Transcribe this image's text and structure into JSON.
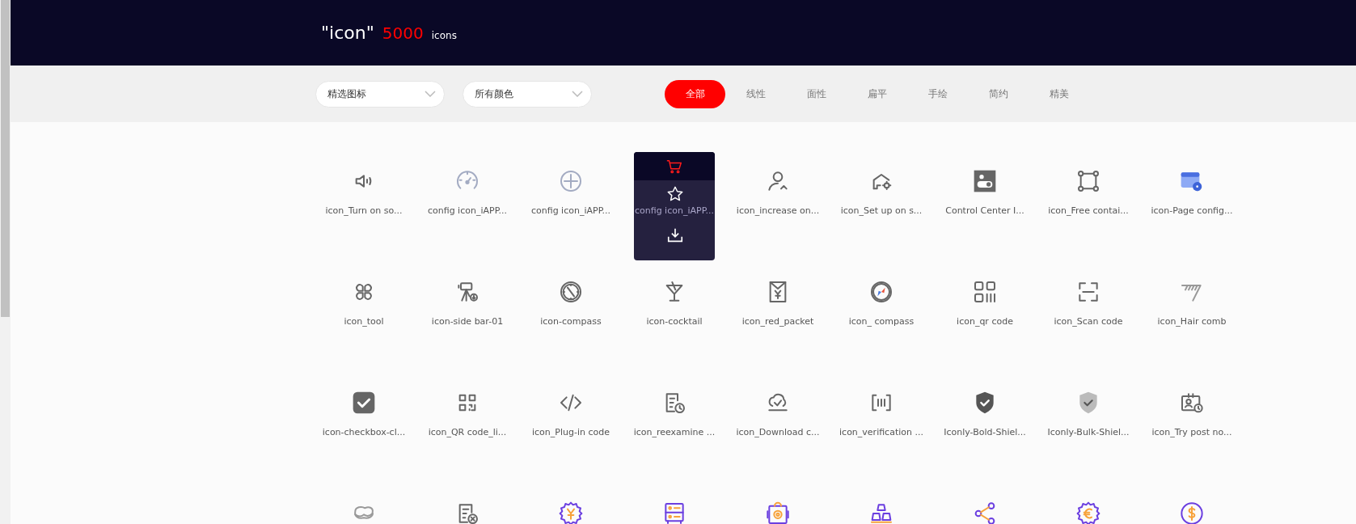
{
  "header": {
    "query": "\"icon\"",
    "count": "5000",
    "unit": "icons"
  },
  "filters": {
    "dropdowns": [
      {
        "value": "精选图标"
      },
      {
        "value": "所有颜色"
      }
    ],
    "tabs": [
      {
        "label": "全部",
        "selected": true
      },
      {
        "label": "线性",
        "selected": false
      },
      {
        "label": "面性",
        "selected": false
      },
      {
        "label": "扁平",
        "selected": false
      },
      {
        "label": "手绘",
        "selected": false
      },
      {
        "label": "简约",
        "selected": false
      },
      {
        "label": "精美",
        "selected": false
      }
    ]
  },
  "icons": [
    {
      "label": "icon_Turn on so...",
      "hovered": false
    },
    {
      "label": "config icon_iAPP...",
      "hovered": false
    },
    {
      "label": "config icon_iAPP...",
      "hovered": false
    },
    {
      "label": "config icon_iAPP...",
      "hovered": true
    },
    {
      "label": "icon_increase on...",
      "hovered": false
    },
    {
      "label": "icon_Set up on s...",
      "hovered": false
    },
    {
      "label": "Control Center I...",
      "hovered": false
    },
    {
      "label": "icon_Free contai...",
      "hovered": false
    },
    {
      "label": "icon-Page config...",
      "hovered": false
    },
    {
      "label": "icon_tool",
      "hovered": false
    },
    {
      "label": "icon-side bar-01",
      "hovered": false
    },
    {
      "label": "icon-compass",
      "hovered": false
    },
    {
      "label": "icon-cocktail",
      "hovered": false
    },
    {
      "label": "icon_red_packet",
      "hovered": false
    },
    {
      "label": "icon_ compass",
      "hovered": false
    },
    {
      "label": "icon_qr code",
      "hovered": false
    },
    {
      "label": "icon_Scan code",
      "hovered": false
    },
    {
      "label": "icon_Hair comb",
      "hovered": false
    },
    {
      "label": "icon-checkbox-cl...",
      "hovered": false
    },
    {
      "label": "icon_QR code_li...",
      "hovered": false
    },
    {
      "label": "icon_Plug-in code",
      "hovered": false
    },
    {
      "label": "icon_reexamine ...",
      "hovered": false
    },
    {
      "label": "icon_Download c...",
      "hovered": false
    },
    {
      "label": "icon_verification ...",
      "hovered": false
    },
    {
      "label": "Iconly-Bold-Shiel...",
      "hovered": false
    },
    {
      "label": "Iconly-Bulk-Shiel...",
      "hovered": false
    },
    {
      "label": "icon_Try post no...",
      "hovered": false
    },
    {
      "hovered": false
    },
    {
      "hovered": false
    },
    {
      "hovered": false
    },
    {
      "hovered": false
    },
    {
      "hovered": false
    },
    {
      "hovered": false
    },
    {
      "hovered": false
    },
    {
      "hovered": false
    },
    {
      "hovered": false
    }
  ]
}
